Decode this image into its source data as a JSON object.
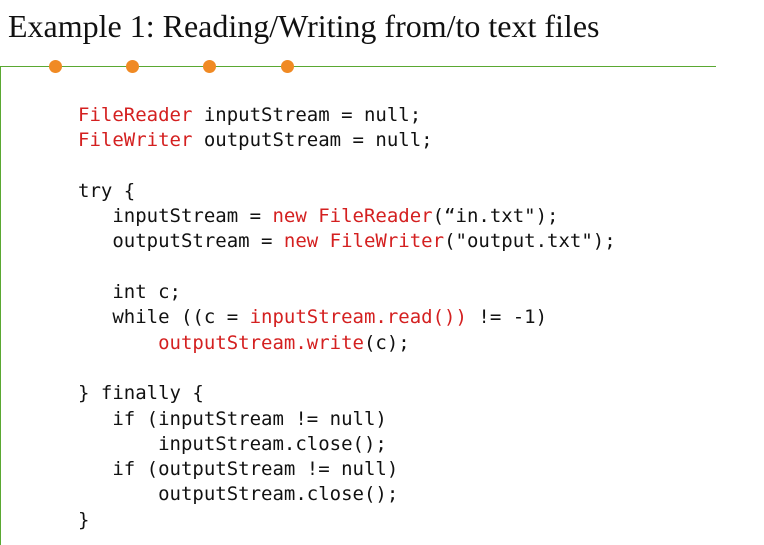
{
  "slide": {
    "title": "Example 1: Reading/Writing from/to text files"
  },
  "code": {
    "lines": [
      [
        {
          "t": "FileReader",
          "c": "red"
        },
        {
          "t": " inputStream = null;"
        }
      ],
      [
        {
          "t": "FileWriter",
          "c": "red"
        },
        {
          "t": " outputStream = null;"
        }
      ],
      [],
      [
        {
          "t": "try {"
        }
      ],
      [
        {
          "t": "   inputStream = "
        },
        {
          "t": "new FileReader",
          "c": "red"
        },
        {
          "t": "(“in.txt\");"
        }
      ],
      [
        {
          "t": "   outputStream = "
        },
        {
          "t": "new FileWriter",
          "c": "red"
        },
        {
          "t": "(\"output.txt\");"
        }
      ],
      [],
      [
        {
          "t": "   int c;"
        }
      ],
      [
        {
          "t": "   while ((c = "
        },
        {
          "t": "inputStream.read())",
          "c": "red"
        },
        {
          "t": " != -1)"
        }
      ],
      [
        {
          "t": "       "
        },
        {
          "t": "outputStream.write",
          "c": "red"
        },
        {
          "t": "(c);"
        }
      ],
      [],
      [
        {
          "t": "} finally {"
        }
      ],
      [
        {
          "t": "   if (inputStream != null)"
        }
      ],
      [
        {
          "t": "       inputStream.close();"
        }
      ],
      [
        {
          "t": "   if (outputStream != null)"
        }
      ],
      [
        {
          "t": "       outputStream.close();"
        }
      ],
      [
        {
          "t": "}"
        }
      ]
    ]
  },
  "colors": {
    "accent_orange": "#f08a24",
    "rule_green": "#5aa832",
    "code_red": "#d42020",
    "text": "#111111"
  }
}
